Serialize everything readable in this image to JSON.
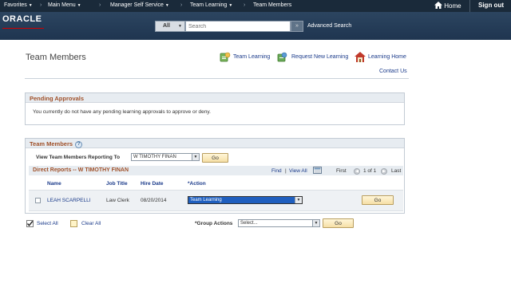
{
  "topbar": {
    "favorites": "Favorites",
    "main_menu": "Main Menu",
    "manager_self_service": "Manager Self Service",
    "team_learning": "Team Learning",
    "team_members": "Team Members",
    "home": "Home",
    "sign_out": "Sign out",
    "separator": "›"
  },
  "header": {
    "logo": "ORACLE",
    "search_scope": "All",
    "search_placeholder": "Search",
    "search_go": "»",
    "advanced_search": "Advanced Search"
  },
  "page": {
    "title": "Team Members",
    "links": {
      "team_learning": "Team Learning",
      "request_new_learning": "Request New Learning",
      "learning_home": "Learning Home",
      "contact_us": "Contact Us"
    }
  },
  "pending": {
    "heading": "Pending Approvals",
    "message": "You currently do not have any pending learning approvals to approve or deny."
  },
  "team": {
    "heading": "Team Members",
    "help_icon": "?",
    "reporting_label": "View Team Members Reporting To",
    "reporting_value": "W TIMOTHY FINAN",
    "go": "Go",
    "grid_title": "Direct Reports -- W TIMOTHY FINAN",
    "find": "Find",
    "view_all": "View All",
    "nav_sep": "|",
    "first": "First",
    "page_info": "1 of 1",
    "last": "Last",
    "columns": {
      "name": "Name",
      "job_title": "Job Title",
      "hire_date": "Hire Date",
      "action": "*Action"
    },
    "rows": [
      {
        "name": "LEAH SCARPELLI",
        "job_title": "Law Clerk",
        "hire_date": "08/20/2014",
        "action": "Team Learning",
        "go": "Go"
      }
    ]
  },
  "bottom": {
    "select_all": "Select All",
    "clear_all": "Clear All",
    "group_actions_label": "*Group Actions",
    "group_actions_value": "Select...",
    "go": "Go"
  },
  "colors": {
    "topbar": "#1a2a3a",
    "header": "#243c57",
    "section_heading": "#a0512a",
    "link": "#1a3a8a",
    "button": "#f6dfa6"
  },
  "icons": {
    "dropdown": "▼",
    "home": "home-icon",
    "team_learning": "team-learning-icon",
    "request_new_learning": "request-learning-icon",
    "learning_home": "house-icon"
  }
}
